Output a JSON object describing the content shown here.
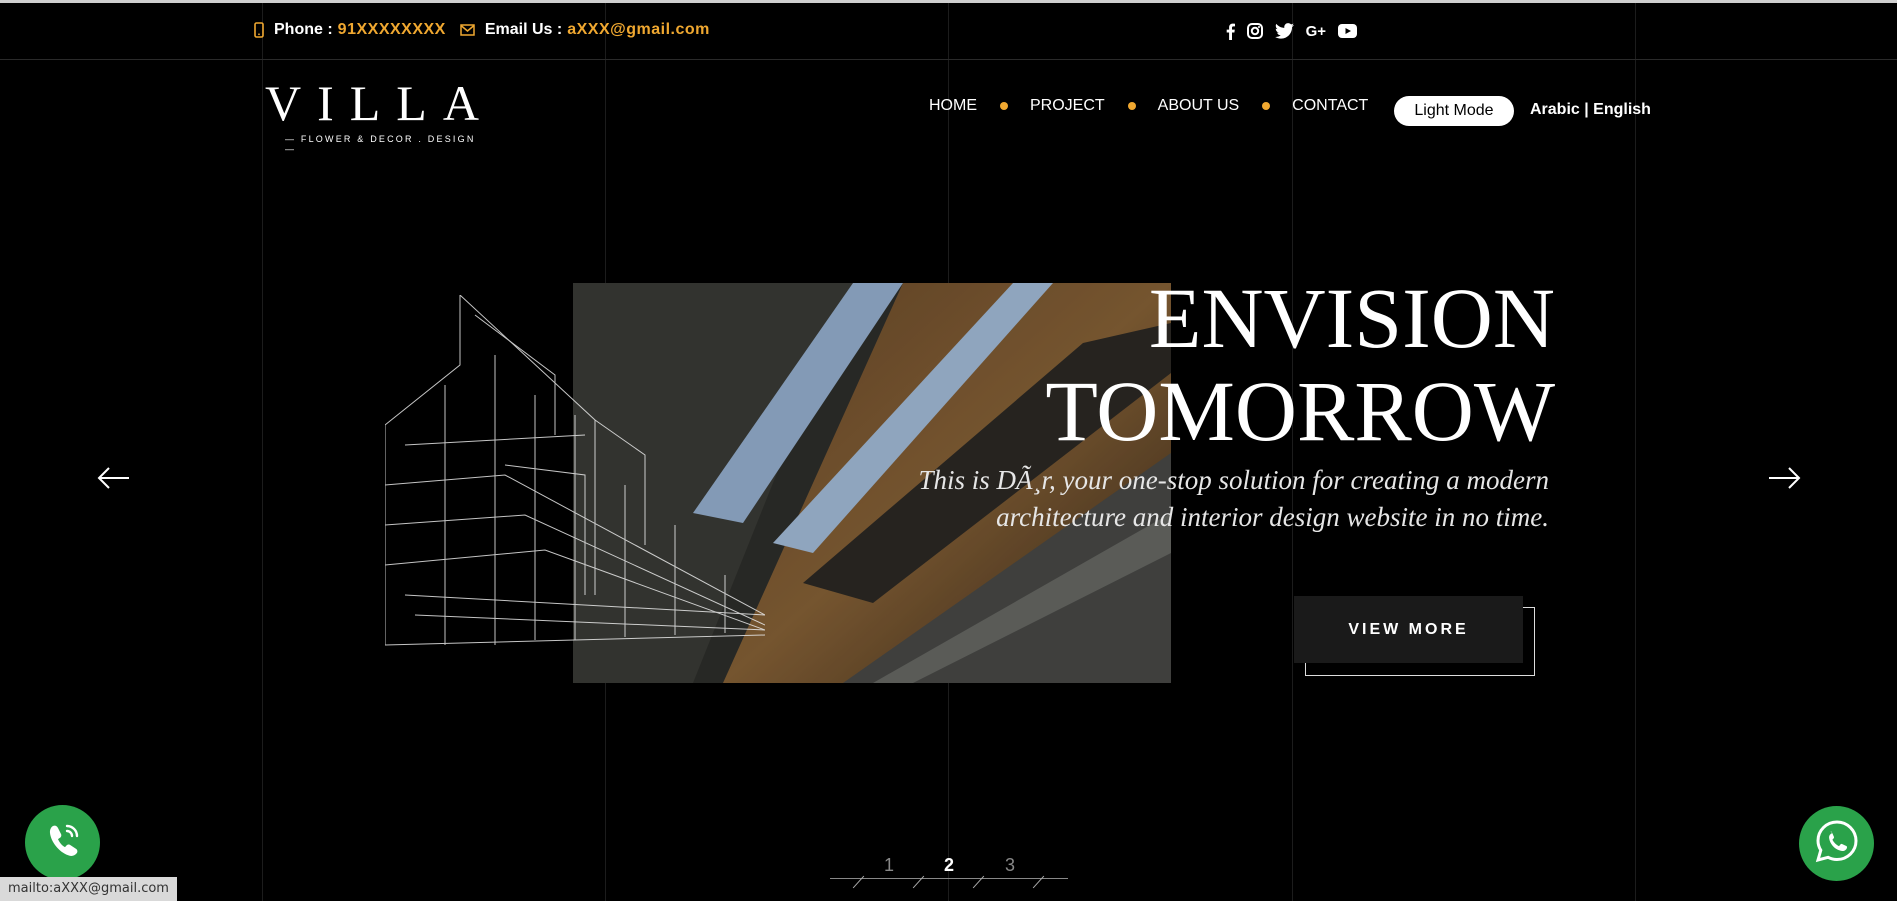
{
  "topbar": {
    "phone_label": "Phone :",
    "phone_value": "91XXXXXXXX",
    "email_label": "Email Us :",
    "email_value": "aXXX@gmail.com",
    "social_icons": [
      "facebook-icon",
      "instagram-icon",
      "twitter-icon",
      "google-plus-icon",
      "youtube-icon"
    ],
    "google_plus_text": "G+"
  },
  "logo": {
    "word": "VILLA",
    "tagline": "— FLOWER & DECOR . DESIGN —"
  },
  "nav": {
    "items": [
      "HOME",
      "PROJECT",
      "ABOUT US",
      "CONTACT"
    ],
    "mode_button": "Light Mode",
    "language": "Arabic | English"
  },
  "hero": {
    "title_line1": "ENVISION",
    "title_line2": "TOMORROW",
    "subtitle": "This is DÃ¸r, your one-stop solution for creating a modern architecture and interior design website in no time.",
    "button": "VIEW MORE"
  },
  "pager": {
    "pages": [
      "1",
      "2",
      "3"
    ],
    "active": "2"
  },
  "status_url": "mailto:aXXX@gmail.com",
  "colors": {
    "accent": "#f0a830",
    "green": "#2aa24a",
    "background": "#000000"
  }
}
